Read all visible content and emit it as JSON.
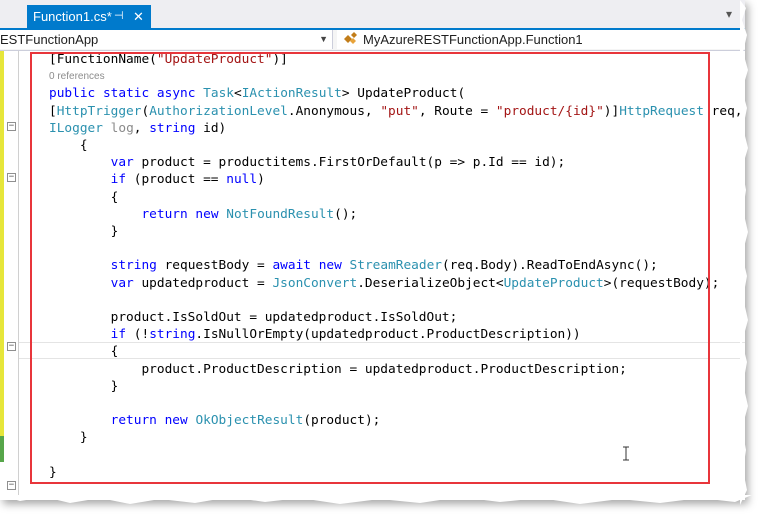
{
  "tab": {
    "title": "Function1.cs*",
    "pin_icon": "pin-icon",
    "close_icon": "close-icon"
  },
  "navbar": {
    "project_dropdown": "ESTFunctionApp",
    "class_dropdown": "MyAzureRESTFunctionApp.Function1",
    "class_icon": "class-icon"
  },
  "code": {
    "codelens": "0 references",
    "lines": [
      {
        "tokens": [
          [
            "",
            "[FunctionName("
          ],
          [
            "st",
            "\"UpdateProduct\""
          ],
          [
            "",
            ")]"
          ]
        ]
      },
      {
        "tokens": []
      },
      {
        "tokens": [
          [
            "kw",
            "public"
          ],
          [
            "",
            " "
          ],
          [
            "kw",
            "static"
          ],
          [
            "",
            " "
          ],
          [
            "kw",
            "async"
          ],
          [
            "",
            " "
          ],
          [
            "ty",
            "Task"
          ],
          [
            "",
            "<"
          ],
          [
            "ty",
            "IActionResult"
          ],
          [
            "",
            "> UpdateProduct("
          ]
        ]
      },
      {
        "tokens": [
          [
            "",
            "["
          ],
          [
            "ty",
            "HttpTrigger"
          ],
          [
            "",
            "("
          ],
          [
            "ty",
            "AuthorizationLevel"
          ],
          [
            "",
            ".Anonymous, "
          ],
          [
            "st",
            "\"put\""
          ],
          [
            "",
            ", Route = "
          ],
          [
            "st",
            "\"product/{id}\""
          ],
          [
            "",
            ")]"
          ],
          [
            "ty",
            "HttpRequest"
          ],
          [
            "",
            " req,"
          ]
        ]
      },
      {
        "tokens": [
          [
            "ty",
            "ILogger"
          ],
          [
            "",
            " "
          ],
          [
            "mu",
            "log"
          ],
          [
            "",
            ", "
          ],
          [
            "kw",
            "string"
          ],
          [
            "",
            " id)"
          ]
        ]
      },
      {
        "tokens": [
          [
            "",
            "    {"
          ]
        ]
      },
      {
        "tokens": [
          [
            "",
            "        "
          ],
          [
            "kw",
            "var"
          ],
          [
            "",
            " product = productitems.FirstOrDefault(p => p.Id == id);"
          ]
        ]
      },
      {
        "tokens": [
          [
            "",
            "        "
          ],
          [
            "kw",
            "if"
          ],
          [
            "",
            " (product == "
          ],
          [
            "kw",
            "null"
          ],
          [
            "",
            ")"
          ]
        ]
      },
      {
        "tokens": [
          [
            "",
            "        {"
          ]
        ]
      },
      {
        "tokens": [
          [
            "",
            "            "
          ],
          [
            "kw",
            "return"
          ],
          [
            "",
            " "
          ],
          [
            "kw",
            "new"
          ],
          [
            "",
            " "
          ],
          [
            "ty",
            "NotFoundResult"
          ],
          [
            "",
            "();"
          ]
        ]
      },
      {
        "tokens": [
          [
            "",
            "        }"
          ]
        ]
      },
      {
        "tokens": []
      },
      {
        "tokens": [
          [
            "",
            "        "
          ],
          [
            "kw",
            "string"
          ],
          [
            "",
            " requestBody = "
          ],
          [
            "kw",
            "await"
          ],
          [
            "",
            " "
          ],
          [
            "kw",
            "new"
          ],
          [
            "",
            " "
          ],
          [
            "ty",
            "StreamReader"
          ],
          [
            "",
            "(req.Body).ReadToEndAsync();"
          ]
        ]
      },
      {
        "tokens": [
          [
            "",
            "        "
          ],
          [
            "kw",
            "var"
          ],
          [
            "",
            " updatedproduct = "
          ],
          [
            "ty",
            "JsonConvert"
          ],
          [
            "",
            ".DeserializeObject<"
          ],
          [
            "ty",
            "UpdateProduct"
          ],
          [
            "",
            ">(requestBody);"
          ]
        ]
      },
      {
        "tokens": []
      },
      {
        "tokens": [
          [
            "",
            "        product.IsSoldOut = updatedproduct.IsSoldOut;"
          ]
        ]
      },
      {
        "tokens": [
          [
            "",
            "        "
          ],
          [
            "kw",
            "if"
          ],
          [
            "",
            " (!"
          ],
          [
            "kw",
            "string"
          ],
          [
            "",
            ".IsNullOrEmpty(updatedproduct.ProductDescription))"
          ]
        ]
      },
      {
        "tokens": [
          [
            "",
            "        {"
          ]
        ]
      },
      {
        "tokens": [
          [
            "",
            "            product.ProductDescription = updatedproduct.ProductDescription;"
          ]
        ]
      },
      {
        "tokens": [
          [
            "",
            "        }"
          ]
        ]
      },
      {
        "tokens": []
      },
      {
        "tokens": [
          [
            "",
            "        "
          ],
          [
            "kw",
            "return"
          ],
          [
            "",
            " "
          ],
          [
            "kw",
            "new"
          ],
          [
            "",
            " "
          ],
          [
            "ty",
            "OkObjectResult"
          ],
          [
            "",
            "(product);"
          ]
        ]
      },
      {
        "tokens": [
          [
            "",
            "    }"
          ]
        ]
      },
      {
        "tokens": []
      },
      {
        "tokens": [
          [
            "",
            "}"
          ]
        ]
      }
    ]
  },
  "colors": {
    "tab_active": "#007acc",
    "keyword": "#0000ff",
    "type": "#2b91af",
    "string": "#a31515",
    "highlight_border": "#e8353b"
  }
}
